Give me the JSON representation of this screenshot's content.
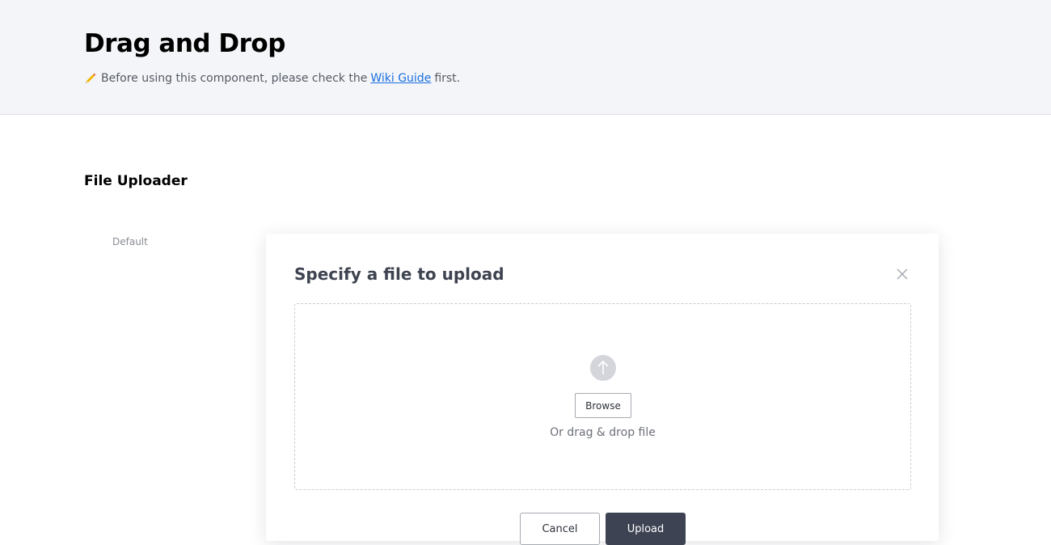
{
  "header": {
    "title": "Drag and Drop",
    "notice_prefix": "Before using this component, please check the",
    "notice_link": "Wiki Guide",
    "notice_suffix": "first.",
    "notice_icon": "pencil-icon"
  },
  "section": {
    "title": "File Uploader",
    "variant_label": "Default"
  },
  "modal": {
    "title": "Specify a file to upload",
    "close_icon": "close-icon",
    "dropzone": {
      "upload_icon": "arrow-up-circle-icon",
      "browse_label": "Browse",
      "hint": "Or drag & drop file"
    },
    "cancel_label": "Cancel",
    "upload_label": "Upload"
  },
  "colors": {
    "header_bg": "#f4f5f8",
    "link": "#1a6fe0",
    "primary_button": "#3d4352",
    "upload_icon": "#d3d5da"
  }
}
